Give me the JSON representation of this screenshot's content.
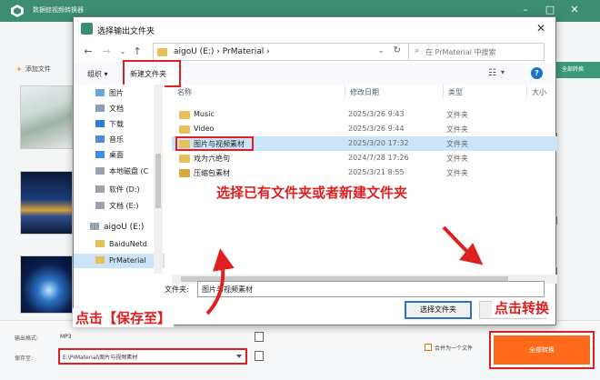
{
  "app": {
    "title": "数据蛙视频转换器",
    "add_file": "添加文件",
    "convert_all_top": "全部转换",
    "output_format_label": "输出格式:",
    "output_format_value": "MP3",
    "save_to_label": "保存至:",
    "save_to_value": "E:\\PrMaterial\\图片与视频素材",
    "merge_label": "合并为一个文件",
    "convert_all_button": "全部转换"
  },
  "dialog": {
    "title": "选择输出文件夹",
    "close": "✕",
    "breadcrumb": "aigoU (E:)  ›  PrMaterial  ›",
    "search_placeholder": "在 PrMaterial 中搜索",
    "organize": "组织 ▾",
    "new_folder": "新建文件夹",
    "help": "?",
    "nav_items": [
      {
        "label": "图片",
        "icon": "pictures-icon"
      },
      {
        "label": "文档",
        "icon": "documents-icon"
      },
      {
        "label": "下载",
        "icon": "downloads-icon"
      },
      {
        "label": "音乐",
        "icon": "music-icon"
      },
      {
        "label": "桌面",
        "icon": "desktop-icon"
      },
      {
        "label": "本地磁盘 (C",
        "icon": "drive-icon"
      },
      {
        "label": "软件 (D:)",
        "icon": "drive-icon"
      },
      {
        "label": "文档 (E:)",
        "icon": "drive-icon"
      },
      {
        "label": "aigoU (E:)",
        "icon": "usb-drive-icon"
      },
      {
        "label": "BaiduNetd",
        "icon": "folder-icon"
      },
      {
        "label": "PrMaterial",
        "icon": "folder-icon"
      }
    ],
    "columns": {
      "name": "名称",
      "modified": "修改日期",
      "type": "类型",
      "size": "大小"
    },
    "files": [
      {
        "name": "Music",
        "modified": "2025/3/26 9:43",
        "type": "文件夹"
      },
      {
        "name": "Video",
        "modified": "2025/3/26 9:44",
        "type": "文件夹"
      },
      {
        "name": "图片与视频素材",
        "modified": "2025/3/20 17:32",
        "type": "文件夹"
      },
      {
        "name": "戏为六绝句",
        "modified": "2024/7/28 17:26",
        "type": "文件夹"
      },
      {
        "name": "压缩包素材",
        "modified": "2025/3/21 8:55",
        "type": "文件夹"
      }
    ],
    "folder_label": "文件夹:",
    "folder_value": "图片与视频素材",
    "select_button": "选择文件夹",
    "cancel_button": ""
  },
  "annotations": {
    "middle": "选择已有文件夹或者新建文件夹",
    "save": "点击【保存至】",
    "convert": "点击转换"
  },
  "colors": {
    "accent": "#3d8d72",
    "annotation": "#e02020",
    "convert": "#ff6a1a",
    "selection": "#cce4f7"
  }
}
